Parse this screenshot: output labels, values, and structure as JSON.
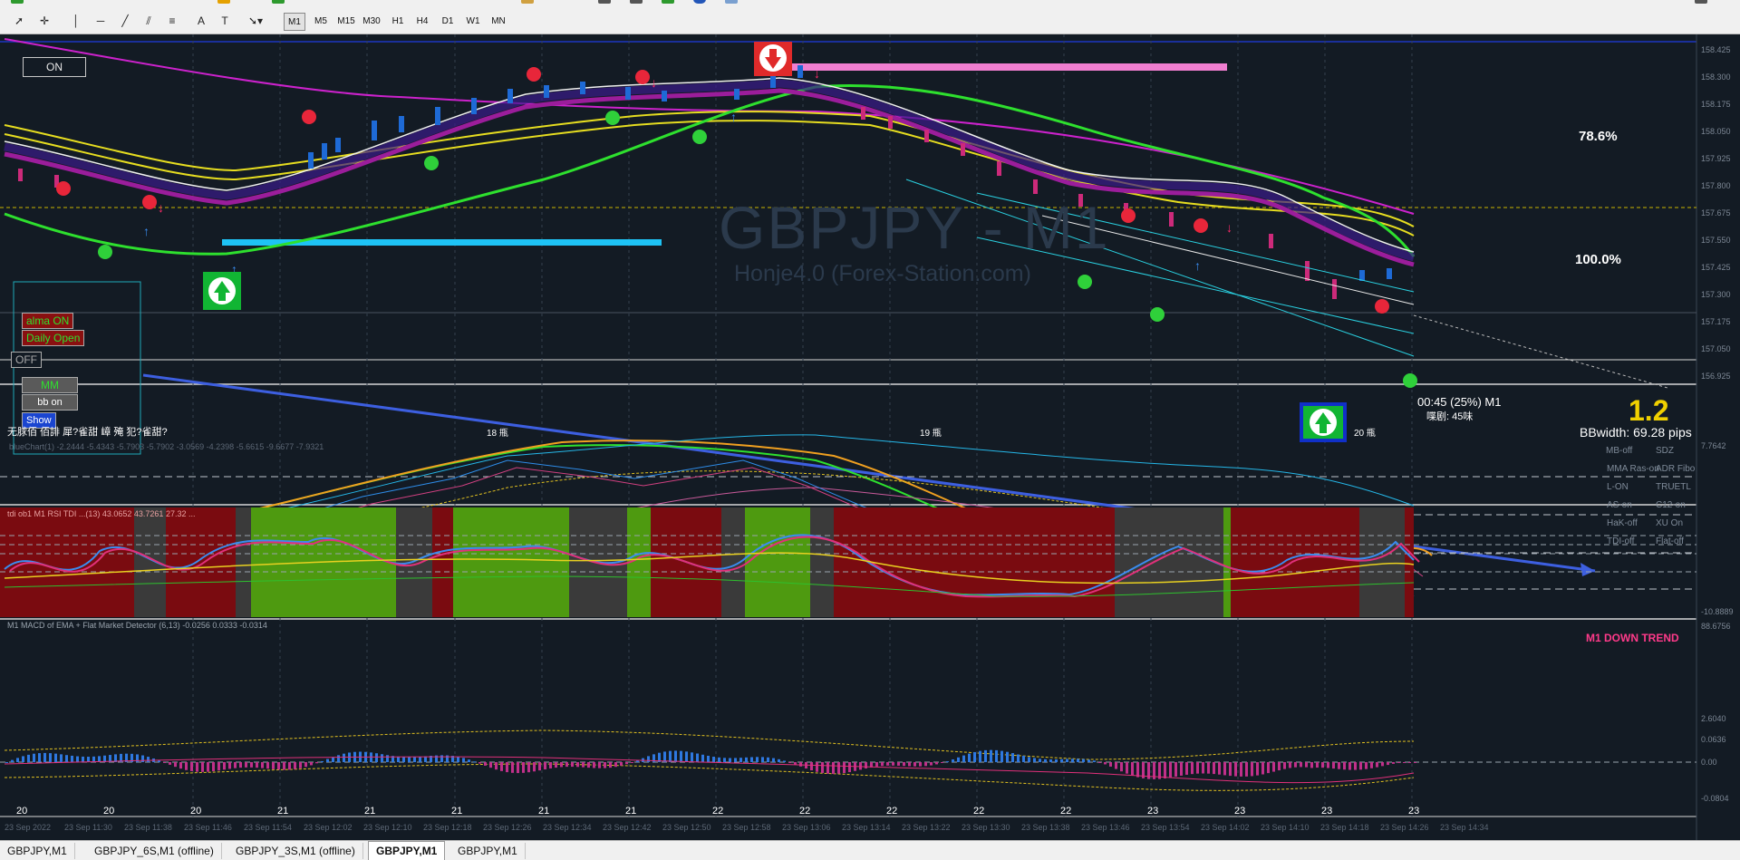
{
  "toolbar": {
    "timeframes": [
      "M1",
      "M5",
      "M15",
      "M30",
      "H1",
      "H4",
      "D1",
      "W1",
      "MN"
    ],
    "active_timeframe": "M1"
  },
  "chart": {
    "on_button": "ON",
    "watermark_symbol": "GBPJPY - M1",
    "watermark_sub": "Honje4.0 (Forex-Station.com)",
    "fib_786": "78.6%",
    "fib_100": "100.0%",
    "panel_buttons": {
      "alma": "alma ON",
      "daily_open": "Daily Open",
      "off": "OFF",
      "mm": "MM",
      "bb": "bb on",
      "show": "Show"
    },
    "countdown": "00:45 (25%) M1",
    "countdown_sub": "喋剧: 45味",
    "bbwidth": "BBwidth: 69.28 pips",
    "big_number": "1.2",
    "panel_status": "无脙佰 佰誹 犀?雀甜 嶂 殗 犯?雀甜?",
    "day_labels": [
      "18 甁",
      "19 甁",
      "20 甁"
    ],
    "ind1_title": "blueChart(1) -2.2444 -5.4343 -5.7903 -5.7902 -3.0569 -4.2398 -5.6615 -9.6677 -7.9321",
    "ind1_right": [
      [
        "MB-off",
        "SDZ"
      ],
      [
        "MMA Ras-on",
        "ADR Fibo"
      ],
      [
        "L-ON",
        "TRUETL"
      ],
      [
        "AS-on",
        "C12-on"
      ],
      [
        "HaK-off",
        "XU On"
      ],
      [
        "TDI-off",
        "Flat-off"
      ]
    ],
    "ind2_title": "tdi ob1 M1 RSI TDI ...(13) 43.0652 43.7261 27.32 ...",
    "ind2_trend": "M1 DOWN TREND",
    "ind3_title": "M1 MACD of EMA + Flat Market Detector (6,13) -0.0256 0.0333 -0.0314",
    "x_labels": [
      "20",
      "20",
      "20",
      "21",
      "21",
      "21",
      "21",
      "21",
      "22",
      "22",
      "22",
      "22",
      "22",
      "23",
      "23",
      "23",
      "23"
    ],
    "x_dates": [
      "23 Sep 2022",
      "23 Sep 11:30",
      "23 Sep 11:38",
      "23 Sep 11:46",
      "23 Sep 11:54",
      "23 Sep 12:02",
      "23 Sep 12:10",
      "23 Sep 12:18",
      "23 Sep 12:26",
      "23 Sep 12:34",
      "23 Sep 12:42",
      "23 Sep 12:50",
      "23 Sep 12:58",
      "23 Sep 13:06",
      "23 Sep 13:14",
      "23 Sep 13:22",
      "23 Sep 13:30",
      "23 Sep 13:38",
      "23 Sep 13:46",
      "23 Sep 13:54",
      "23 Sep 14:02",
      "23 Sep 14:10",
      "23 Sep 14:18",
      "23 Sep 14:26",
      "23 Sep 14:34"
    ],
    "main_prices": [
      "158.425",
      "158.300",
      "158.175",
      "158.050",
      "157.925",
      "157.800",
      "157.675",
      "157.550",
      "157.425",
      "157.300",
      "157.175",
      "157.050",
      "156.925"
    ],
    "ind1_scale": [
      "7.7642",
      "-10.8889"
    ],
    "ind2_scale": [
      "88.6756",
      "2.6040"
    ],
    "ind3_scale": [
      "0.0636",
      "0.00",
      "-0.0804"
    ]
  },
  "tabs": [
    "GBPJPY,M1",
    "GBPJPY_6S,M1 (offline)",
    "GBPJPY_3S,M1 (offline)",
    "GBPJPY,M1",
    "GBPJPY,M1"
  ],
  "active_tab_index": 3
}
